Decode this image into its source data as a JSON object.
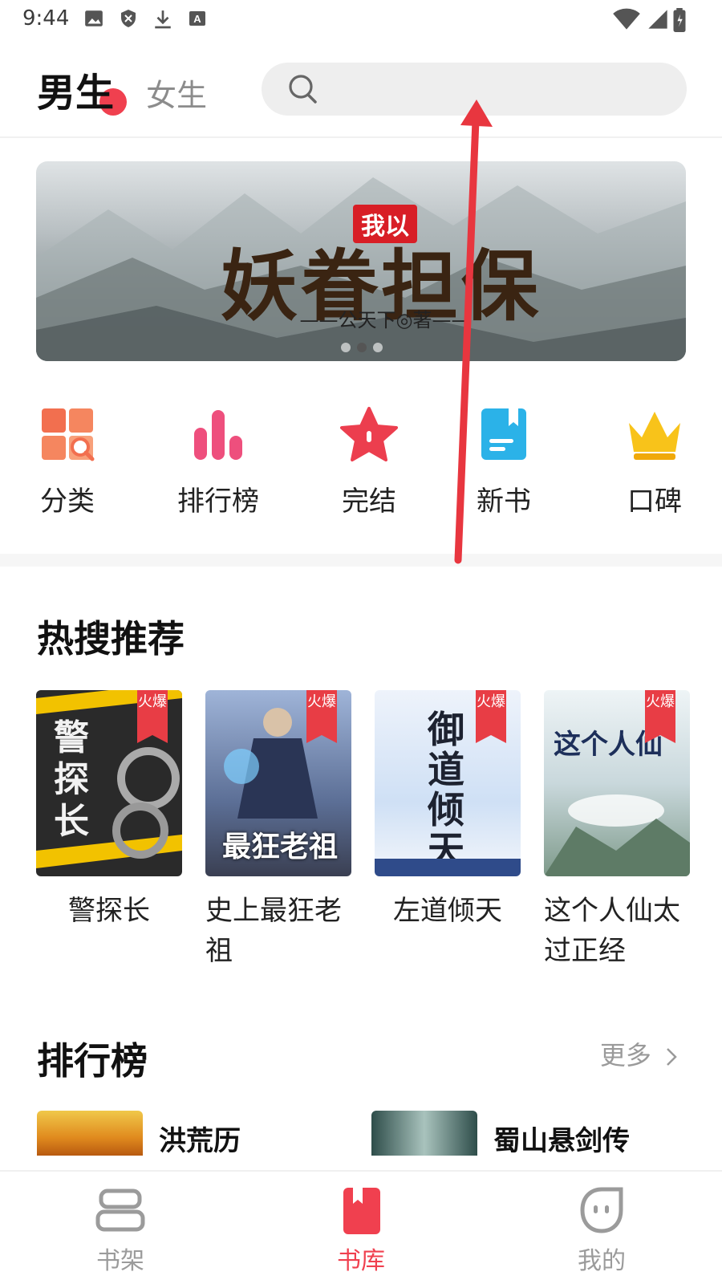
{
  "status_bar": {
    "time": "9:44"
  },
  "header": {
    "tab_male": "男生",
    "tab_female": "女生",
    "search_placeholder": ""
  },
  "banner": {
    "tag": "我以",
    "title": "妖眷担保",
    "author": "——公天下◎著——"
  },
  "categories": [
    {
      "label": "分类",
      "icon": "category-icon"
    },
    {
      "label": "排行榜",
      "icon": "ranking-icon"
    },
    {
      "label": "完结",
      "icon": "star-icon"
    },
    {
      "label": "新书",
      "icon": "new-book-icon"
    },
    {
      "label": "口碑",
      "icon": "crown-icon"
    }
  ],
  "hot_search": {
    "title": "热搜推荐",
    "badge": "火爆",
    "books": [
      {
        "title": "警探长",
        "cover_text": "警探长"
      },
      {
        "title": "史上最狂老祖",
        "cover_text": "最狂老祖"
      },
      {
        "title": "左道倾天",
        "cover_text": "御道倾天"
      },
      {
        "title": "这个人仙太过正经",
        "cover_text": "这个人仙"
      }
    ]
  },
  "ranking": {
    "title": "排行榜",
    "more": "更多",
    "items": [
      {
        "name": "洪荒历"
      },
      {
        "name": "蜀山悬剑传"
      }
    ]
  },
  "bottom_nav": {
    "items": [
      {
        "label": "书架",
        "icon": "bookshelf-icon"
      },
      {
        "label": "书库",
        "icon": "library-icon",
        "active": true
      },
      {
        "label": "我的",
        "icon": "profile-icon"
      }
    ]
  },
  "colors": {
    "accent": "#f0404f",
    "search_bg": "#eeeeee",
    "hot_badge": "#e83d45"
  }
}
